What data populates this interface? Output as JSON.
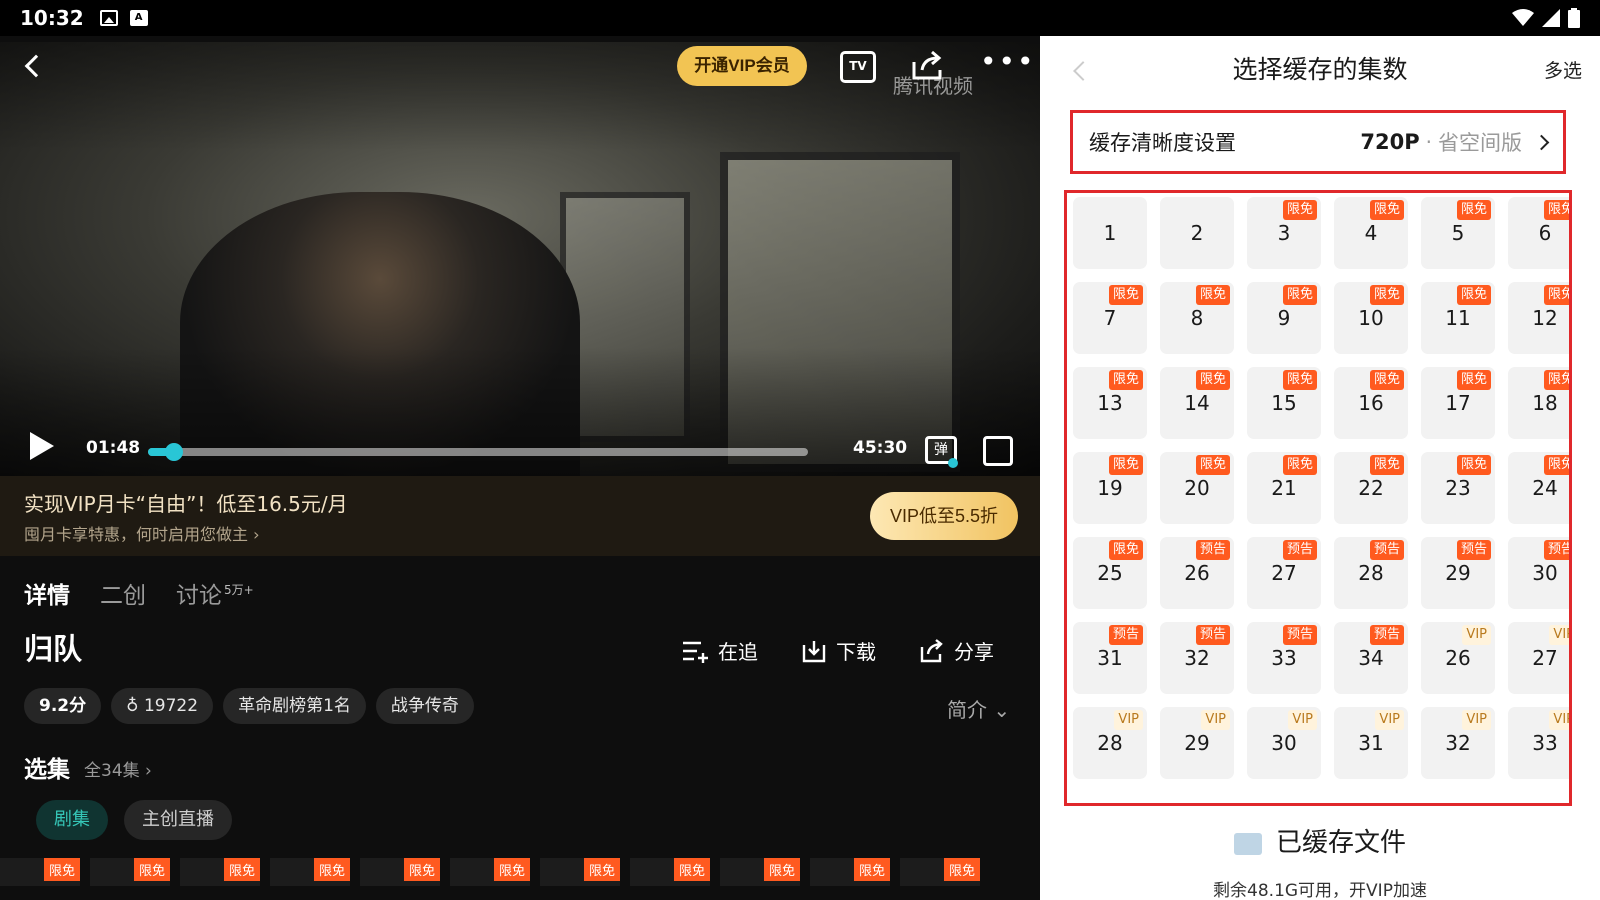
{
  "status_bar": {
    "time": "10:32"
  },
  "player": {
    "vip_open_label": "开通VIP会员",
    "tv_icon_label": "TV",
    "watermark": "腾讯视频",
    "current_time": "01:48",
    "total_time": "45:30",
    "progress": 0.04,
    "danmu_label": "弹"
  },
  "vip_banner": {
    "title": "实现VIP月卡“自由”！低至16.5元/月",
    "subtitle": "囤月卡享特惠，何时启用您做主 ›",
    "button": "VIP低至5.5折"
  },
  "tabs": [
    {
      "label": "详情",
      "badge": ""
    },
    {
      "label": "二创",
      "badge": ""
    },
    {
      "label": "讨论",
      "badge": "5万+"
    }
  ],
  "show": {
    "title": "归队",
    "actions": {
      "follow": "在追",
      "download": "下载",
      "share": "分享"
    },
    "tags": [
      "9.2分",
      "19722",
      "革命剧榜第1名",
      "战争传奇"
    ],
    "intro": "简介",
    "episodes_title": "选集",
    "episodes_count": "全34集 ›",
    "sub_tabs": [
      "剧集",
      "主创直播"
    ],
    "strip_badge": "限免"
  },
  "panel": {
    "title": "选择缓存的集数",
    "multi_select": "多选",
    "quality_label": "缓存清晰度设置",
    "quality_value": "720P",
    "quality_dot": "·",
    "quality_mode": "省空间版",
    "badge_labels": {
      "free": "限免",
      "preview": "预告",
      "vip": "VIP"
    },
    "episodes": [
      {
        "num": "1",
        "badge": ""
      },
      {
        "num": "2",
        "badge": ""
      },
      {
        "num": "3",
        "badge": "free"
      },
      {
        "num": "4",
        "badge": "free"
      },
      {
        "num": "5",
        "badge": "free"
      },
      {
        "num": "6",
        "badge": "free"
      },
      {
        "num": "7",
        "badge": "free"
      },
      {
        "num": "8",
        "badge": "free"
      },
      {
        "num": "9",
        "badge": "free"
      },
      {
        "num": "10",
        "badge": "free"
      },
      {
        "num": "11",
        "badge": "free"
      },
      {
        "num": "12",
        "badge": "free"
      },
      {
        "num": "13",
        "badge": "free"
      },
      {
        "num": "14",
        "badge": "free"
      },
      {
        "num": "15",
        "badge": "free"
      },
      {
        "num": "16",
        "badge": "free"
      },
      {
        "num": "17",
        "badge": "free"
      },
      {
        "num": "18",
        "badge": "free"
      },
      {
        "num": "19",
        "badge": "free"
      },
      {
        "num": "20",
        "badge": "free"
      },
      {
        "num": "21",
        "badge": "free"
      },
      {
        "num": "22",
        "badge": "free"
      },
      {
        "num": "23",
        "badge": "free"
      },
      {
        "num": "24",
        "badge": "free"
      },
      {
        "num": "25",
        "badge": "free"
      },
      {
        "num": "26",
        "badge": "preview"
      },
      {
        "num": "27",
        "badge": "preview"
      },
      {
        "num": "28",
        "badge": "preview"
      },
      {
        "num": "29",
        "badge": "preview"
      },
      {
        "num": "30",
        "badge": "preview"
      },
      {
        "num": "31",
        "badge": "preview"
      },
      {
        "num": "32",
        "badge": "preview"
      },
      {
        "num": "33",
        "badge": "preview"
      },
      {
        "num": "34",
        "badge": "preview"
      },
      {
        "num": "26",
        "badge": "vip"
      },
      {
        "num": "27",
        "badge": "vip"
      },
      {
        "num": "28",
        "badge": "vip"
      },
      {
        "num": "29",
        "badge": "vip"
      },
      {
        "num": "30",
        "badge": "vip"
      },
      {
        "num": "31",
        "badge": "vip"
      },
      {
        "num": "32",
        "badge": "vip"
      },
      {
        "num": "33",
        "badge": "vip"
      }
    ],
    "cached_files": "已缓存文件",
    "storage_text": "剩余48.1G可用，开VIP加速"
  }
}
